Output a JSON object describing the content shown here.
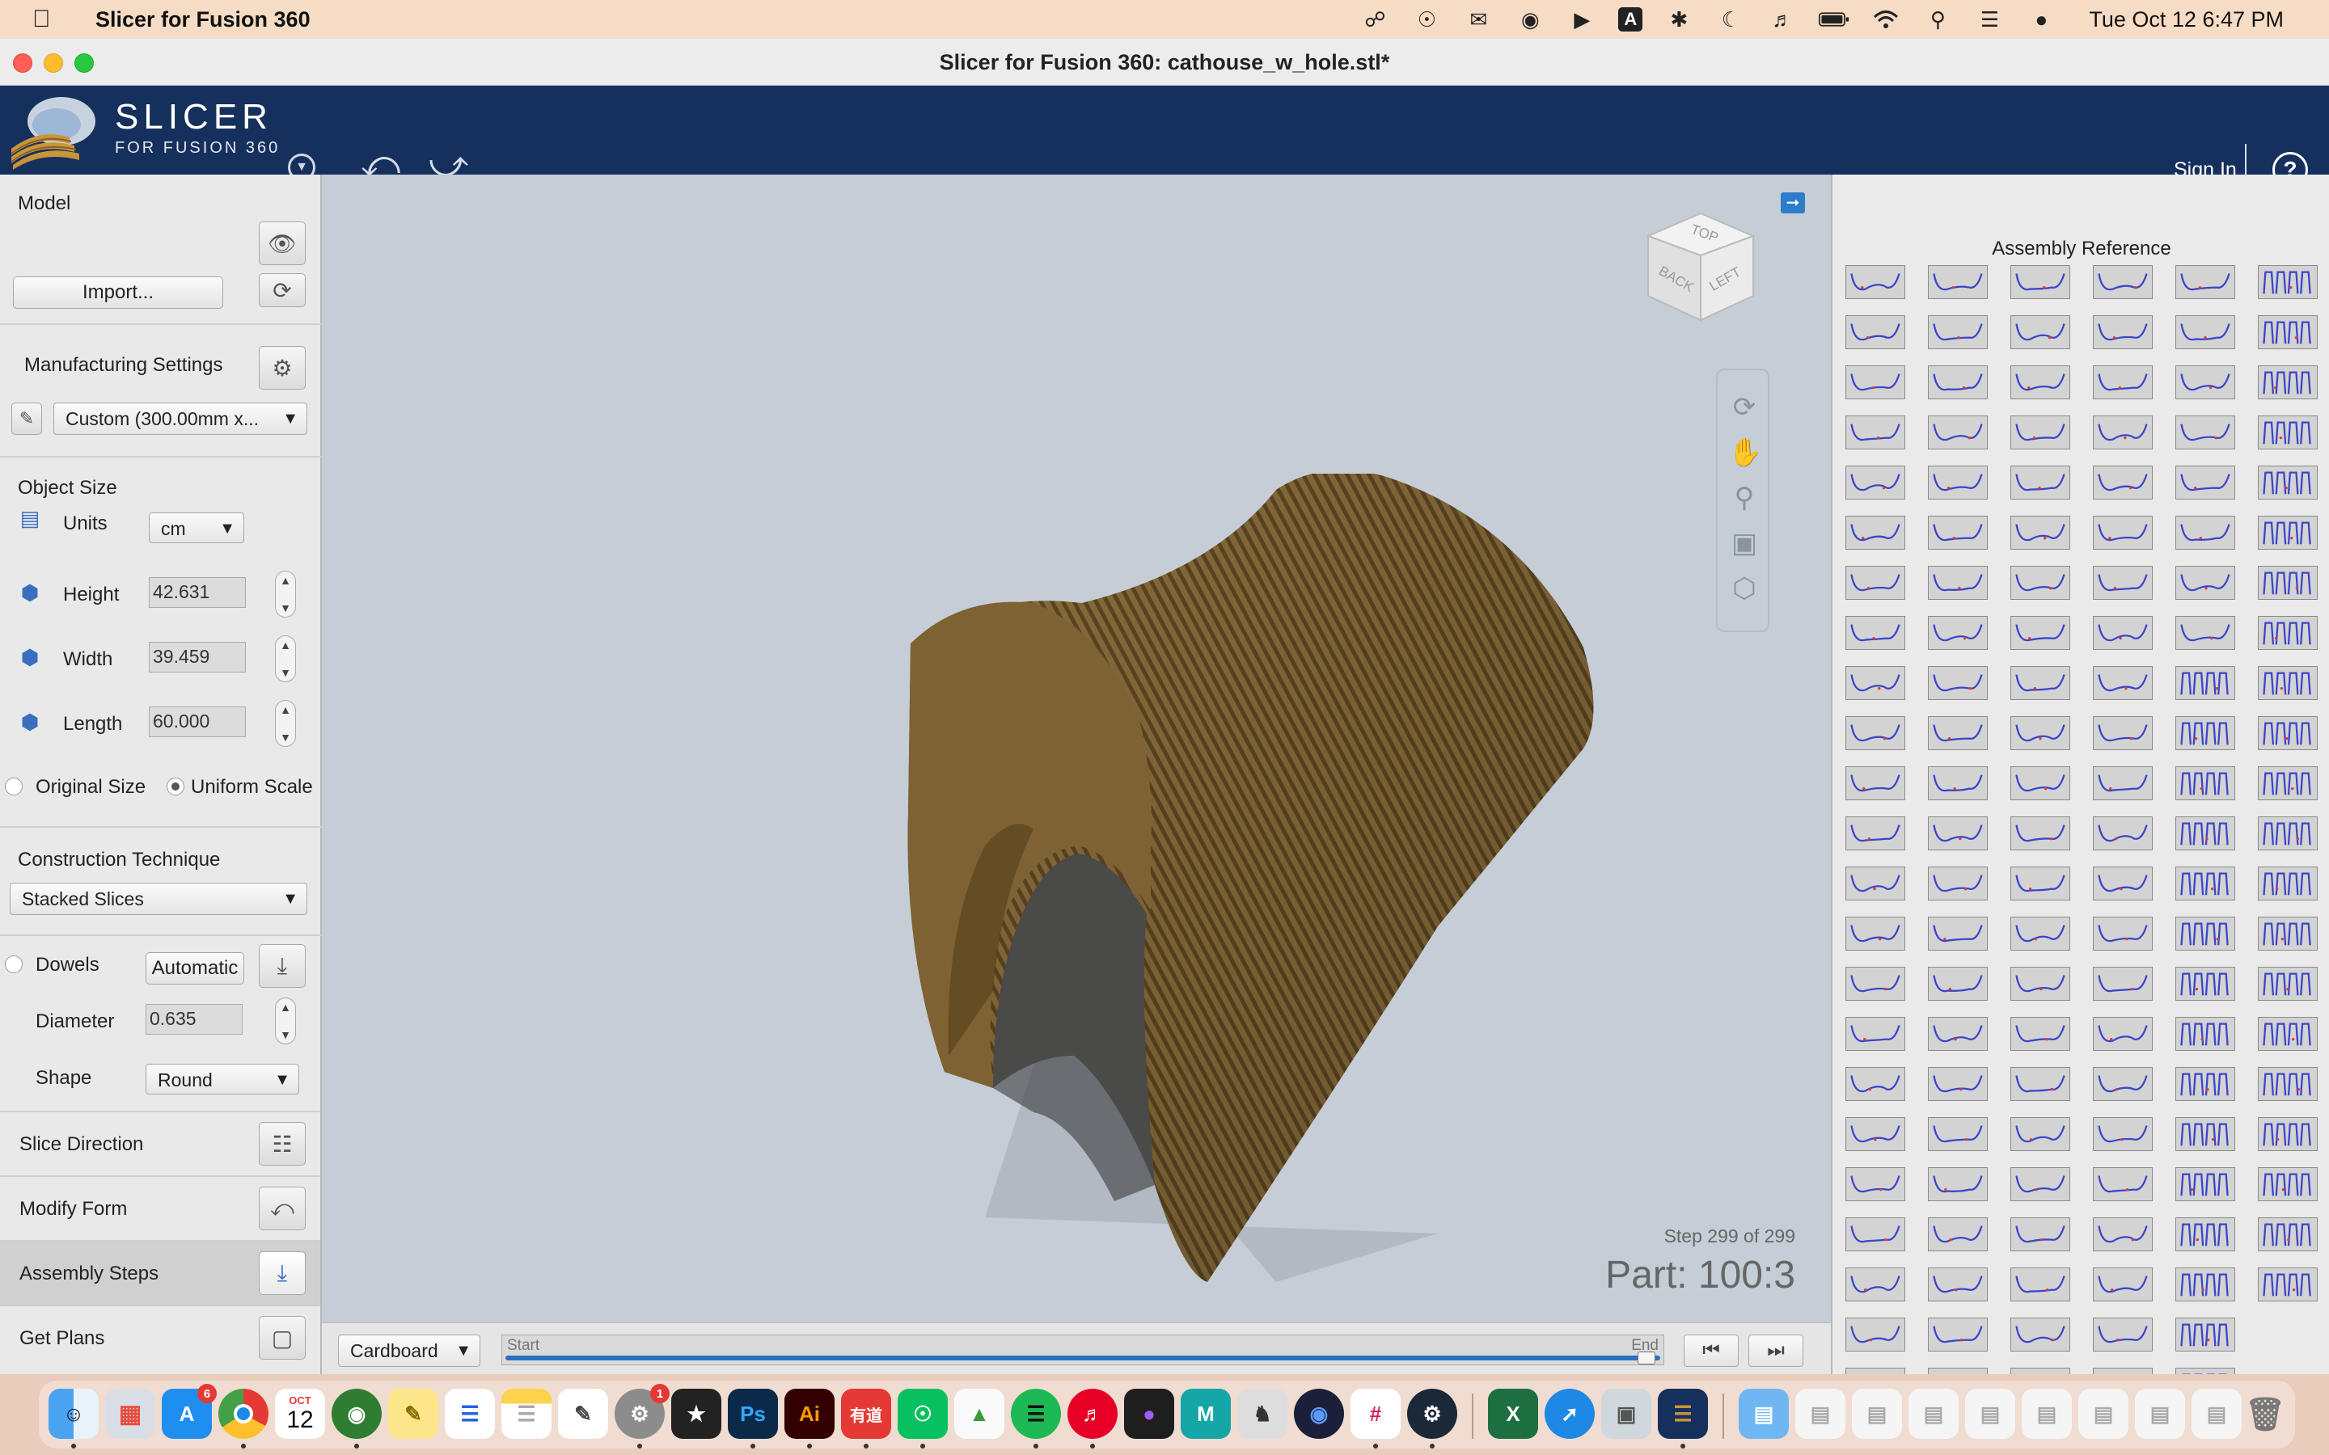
{
  "menubar": {
    "app_name": "Slicer for Fusion 360",
    "status_icons": [
      "creative-cloud-icon",
      "wechat-icon",
      "chat-icon",
      "globe-icon",
      "play-icon",
      "input-method-icon",
      "bluetooth-icon",
      "moon-icon",
      "volume-icon",
      "battery-icon",
      "wifi-icon",
      "search-icon",
      "control-center-icon",
      "siri-icon"
    ],
    "input_method_label": "A",
    "clock": "Tue Oct 12  6:47 PM"
  },
  "window": {
    "title": "Slicer for Fusion 360: cathouse_w_hole.stl*"
  },
  "header": {
    "logo_main": "SLICER",
    "logo_sub": "FOR FUSION 360",
    "sign_in": "Sign In",
    "help": "?"
  },
  "left_panel": {
    "model_label": "Model",
    "import_label": "Import...",
    "manufacturing_label": "Manufacturing Settings",
    "manufacturing_value": "Custom (300.00mm x...",
    "object_size_label": "Object Size",
    "units_label": "Units",
    "units_value": "cm",
    "height_label": "Height",
    "height_value": "42.631",
    "width_label": "Width",
    "width_value": "39.459",
    "length_label": "Length",
    "length_value": "60.000",
    "original_size_label": "Original Size",
    "uniform_scale_label": "Uniform Scale",
    "construction_label": "Construction Technique",
    "construction_value": "Stacked Slices",
    "dowels_label": "Dowels",
    "dowels_mode": "Automatic",
    "diameter_label": "Diameter",
    "diameter_value": "0.635",
    "shape_label": "Shape",
    "shape_value": "Round",
    "slice_direction_label": "Slice Direction",
    "modify_form_label": "Modify Form",
    "assembly_steps_label": "Assembly Steps",
    "get_plans_label": "Get Plans"
  },
  "viewport": {
    "cube_top": "TOP",
    "cube_back": "BACK",
    "cube_left": "LEFT",
    "step_label": "Step 299 of 299",
    "part_label": "Part: 100:3",
    "material_value": "Cardboard",
    "timeline_start": "Start",
    "timeline_end": "End",
    "timeline_progress": 1.0,
    "model_color": "#8a6d3b"
  },
  "right_panel": {
    "title": "Assembly Reference",
    "columns": 6,
    "rows": 23,
    "last_row_count": 5,
    "second_last_row_count": 5
  },
  "colors": {
    "header_bg": "#16305e",
    "accent": "#2d6fc2",
    "menubar_bg": "#f6dcc5"
  },
  "dock": {
    "icons": [
      "finder-icon",
      "launchpad-icon",
      "app-store-icon",
      "chrome-icon",
      "globe-app-icon",
      "stickies-icon",
      "reminders-icon",
      "notes-icon",
      "textedit-icon",
      "system-preferences-icon",
      "final-cut-icon",
      "photoshop-icon",
      "illustrator-icon",
      "youdao-icon",
      "wechat-icon",
      "navigation-icon",
      "spotify-icon",
      "netease-music-icon",
      "figma-icon",
      "maya-icon",
      "horse-icon",
      "cinema4d-icon",
      "slack-icon",
      "steam-icon",
      "excel-icon",
      "safari-icon",
      "preview-icon",
      "slicer-icon",
      "folder-icon",
      "doc-thumb-1",
      "doc-thumb-2",
      "doc-thumb-3",
      "doc-thumb-4",
      "doc-thumb-5",
      "doc-thumb-6",
      "doc-thumb-7",
      "doc-thumb-8",
      "trash-icon"
    ],
    "app_store_badge": "6",
    "sysprefs_badge": "1",
    "calendar_month": "OCT",
    "calendar_day": "12",
    "photoshop_label": "Ps",
    "illustrator_label": "Ai",
    "youdao_label": "有道",
    "maya_label": "M",
    "excel_label": "X"
  }
}
